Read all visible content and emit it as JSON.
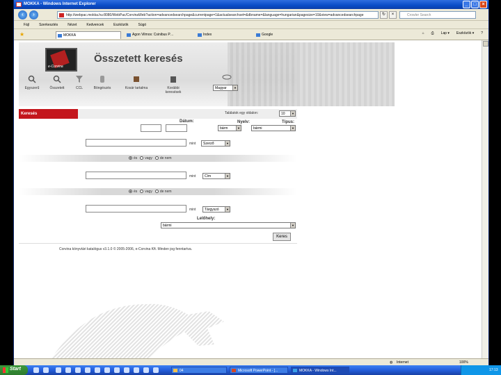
{
  "window": {
    "title": "MOKKA - Windows Internet Explorer",
    "buttons": [
      "_",
      "□",
      "×"
    ]
  },
  "address_bar": {
    "url": "http://webpac.mokka.hu:8080/WebPac/CorvinaWeb?action=advancedsearchpage&currentpage=1&actualsearchset=&dbname=&language=hungarian&pagesize=10&view=advancedsearchpage",
    "search_placeholder": "Crowler Search"
  },
  "menu": [
    "Fájl",
    "Szerkesztés",
    "Nézet",
    "Kedvencek",
    "Eszközök",
    "Súgó"
  ],
  "tabs": [
    {
      "label": "MOKKA",
      "active": true
    },
    {
      "label": "Agon Vilmos: Csinibus P…",
      "active": false
    },
    {
      "label": "Index",
      "active": false
    },
    {
      "label": "Google",
      "active": false
    }
  ],
  "right_tools": [
    "Lap ▾",
    "Eszközök ▾"
  ],
  "page": {
    "logo_text": "e-Corvina",
    "title": "Összetett keresés",
    "tools": [
      "Egyszerű",
      "Összetett",
      "CCL",
      "Böngészés",
      "Kosár tartalma",
      "Korábbi keresések"
    ],
    "language": "Magyar",
    "section": "Keresés",
    "results_per_page_label": "Találatok egy oldalon:",
    "results_per_page": "10",
    "date_label": "Dátum:",
    "language_label": "Nyelv:",
    "type_label": "Típus:",
    "language_value": "bárm",
    "type_value": "bármi",
    "mint": "mint",
    "field1": "Szerző",
    "field2": "Cím",
    "field3": "Tárgyszó",
    "radio_labels": [
      "és",
      "vagy",
      "de nem"
    ],
    "location_label": "Lelőhely:",
    "location_value": "bármi",
    "search_button": "Keres",
    "footer": "Corvina könyvtári katalógus v3.1.0 © 2005-2006, e-Corvina Kft. Minden jog fenntartva."
  },
  "statusbar": {
    "zone": "Internet",
    "zoom": "100%"
  },
  "taskbar": {
    "start": "Start",
    "items": [
      {
        "label": "04",
        "active": false
      },
      {
        "label": "Microsoft PowerPoint - [...",
        "active": false
      },
      {
        "label": "MOKKA - Windows Int...",
        "active": true
      }
    ],
    "clock": "17:13"
  }
}
